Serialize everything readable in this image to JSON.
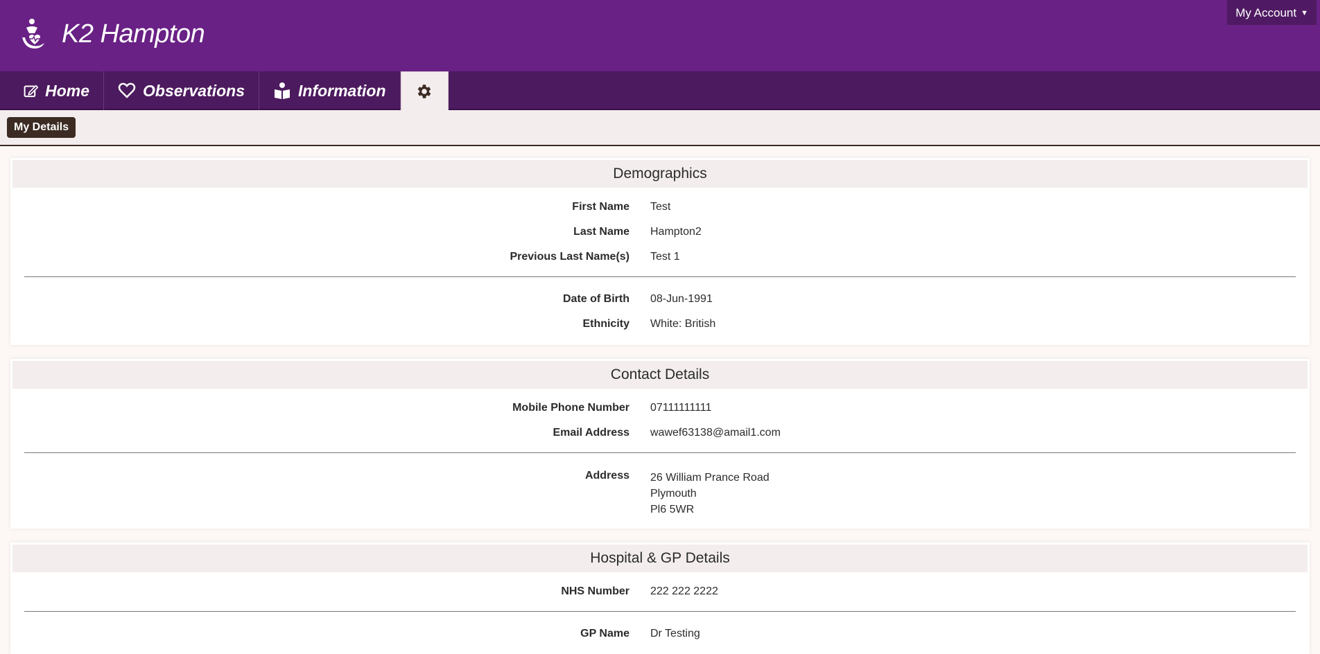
{
  "header": {
    "app_title": "K2 Hampton",
    "account_label": "My Account"
  },
  "nav": {
    "home": "Home",
    "observations": "Observations",
    "information": "Information"
  },
  "subnav": {
    "active": "My Details"
  },
  "demographics": {
    "title": "Demographics",
    "first_name_label": "First Name",
    "first_name": "Test",
    "last_name_label": "Last Name",
    "last_name": "Hampton2",
    "prev_last_name_label": "Previous Last Name(s)",
    "prev_last_name": "Test 1",
    "dob_label": "Date of Birth",
    "dob": "08-Jun-1991",
    "ethnicity_label": "Ethnicity",
    "ethnicity": "White: British"
  },
  "contact": {
    "title": "Contact Details",
    "mobile_label": "Mobile Phone Number",
    "mobile": "07111111111",
    "email_label": "Email Address",
    "email": "wawef63138@amail1.com",
    "address_label": "Address",
    "address_line1": "26 William Prance Road",
    "address_line2": "Plymouth",
    "address_line3": "Pl6 5WR"
  },
  "hospital": {
    "title": "Hospital & GP Details",
    "nhs_label": "NHS Number",
    "nhs": "222 222 2222",
    "gp_name_label": "GP Name",
    "gp_name": "Dr Testing"
  },
  "colors": {
    "header": "#692185",
    "nav": "#4c1a5e",
    "pill": "#3b2b22"
  }
}
